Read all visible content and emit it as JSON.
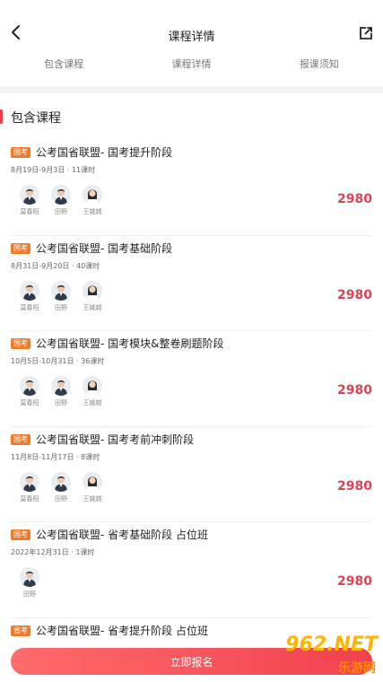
{
  "header": {
    "title": "课程详情",
    "back_icon": "chevron-left-icon",
    "share_icon": "share-external-icon"
  },
  "tabs": [
    {
      "label": "包含课程"
    },
    {
      "label": "课程详情"
    },
    {
      "label": "报课须知"
    }
  ],
  "section": {
    "title": "包含课程",
    "accent": "#e8404a"
  },
  "courses": [
    {
      "badge": "国考",
      "title": "公考国省联盟- 国考提升阶段",
      "meta": "8月19日-9月3日 · 11课时",
      "teachers": [
        "莫春阳",
        "田野",
        "王姚越"
      ],
      "price": "2980"
    },
    {
      "badge": "国考",
      "title": "公考国省联盟- 国考基础阶段",
      "meta": "8月31日-9月20日 · 40课时",
      "teachers": [
        "莫春阳",
        "田野",
        "王姚越"
      ],
      "price": "2980"
    },
    {
      "badge": "国考",
      "title": "公考国省联盟- 国考模块&整卷刷题阶段",
      "meta": "10月5日-10月31日 · 36课时",
      "teachers": [
        "莫春阳",
        "田野",
        "王姚越"
      ],
      "price": "2980"
    },
    {
      "badge": "国考",
      "title": "公考国省联盟- 国考考前冲刺阶段",
      "meta": "11月8日-11月17日 · 8课时",
      "teachers": [
        "莫春阳",
        "田野",
        "王姚越"
      ],
      "price": "2980"
    },
    {
      "badge": "国考",
      "title": "公考国省联盟- 省考基础阶段 占位班",
      "meta": "2022年12月31日 · 1课时",
      "teachers": [
        "田野"
      ],
      "price": "2980"
    },
    {
      "badge": "省考",
      "title": "公考国省联盟- 省考提升阶段 占位班",
      "meta": "",
      "teachers": [],
      "price": ""
    }
  ],
  "footer": {
    "enroll_label": "立即报名"
  },
  "watermark": {
    "main": "962.NET",
    "sub": "乐游网"
  },
  "colors": {
    "price": "#d94452",
    "badge": "#f07b2c",
    "button": "#f1414e"
  }
}
